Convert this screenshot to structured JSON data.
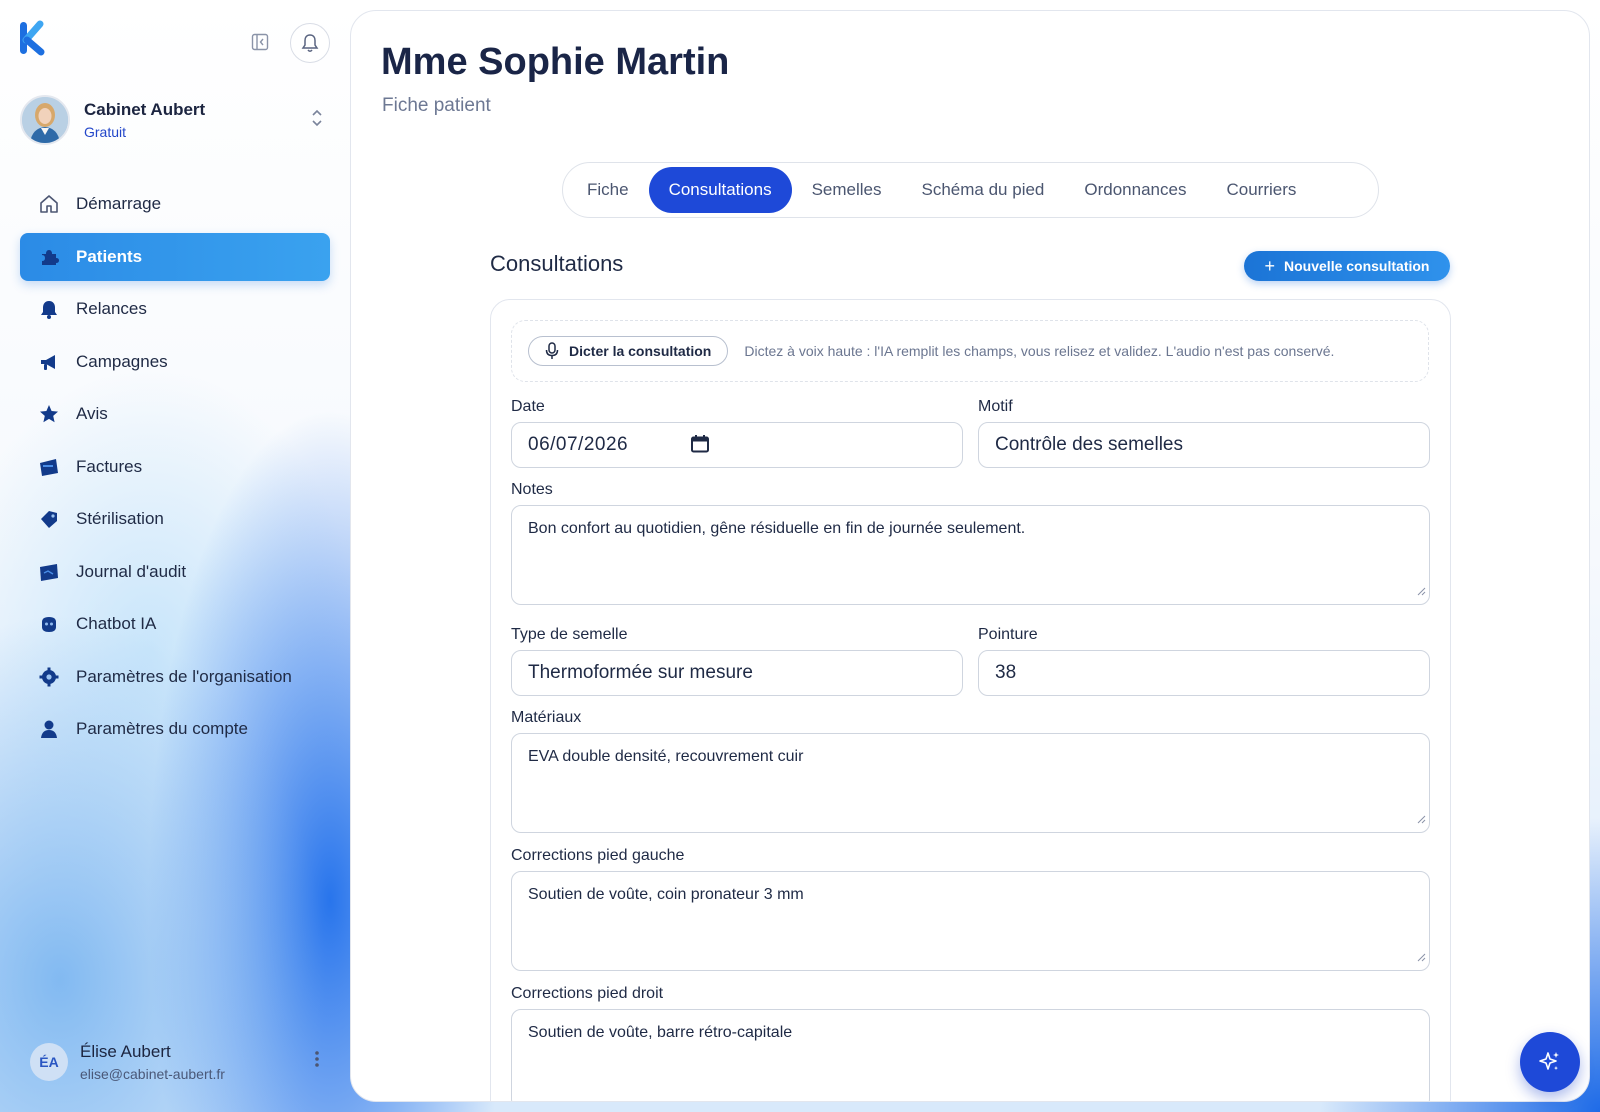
{
  "sidebar": {
    "org": {
      "name": "Cabinet Aubert",
      "plan": "Gratuit"
    },
    "items": [
      {
        "label": "Démarrage",
        "icon": "home-icon",
        "active": false
      },
      {
        "label": "Patients",
        "icon": "puzzle-icon",
        "active": true
      },
      {
        "label": "Relances",
        "icon": "bell-icon",
        "active": false
      },
      {
        "label": "Campagnes",
        "icon": "megaphone-icon",
        "active": false
      },
      {
        "label": "Avis",
        "icon": "star-icon",
        "active": false
      },
      {
        "label": "Factures",
        "icon": "wallet-icon",
        "active": false
      },
      {
        "label": "Stérilisation",
        "icon": "tag-icon",
        "active": false
      },
      {
        "label": "Journal d'audit",
        "icon": "journal-icon",
        "active": false
      },
      {
        "label": "Chatbot IA",
        "icon": "bot-icon",
        "active": false
      },
      {
        "label": "Paramètres de l'organisation",
        "icon": "gear-icon",
        "active": false
      },
      {
        "label": "Paramètres du compte",
        "icon": "user-icon",
        "active": false
      }
    ],
    "user": {
      "initials": "ÉA",
      "name": "Élise Aubert",
      "email": "elise@cabinet-aubert.fr"
    }
  },
  "header": {
    "title": "Mme Sophie Martin",
    "subtitle": "Fiche patient"
  },
  "tabs": [
    {
      "label": "Fiche",
      "active": false
    },
    {
      "label": "Consultations",
      "active": true
    },
    {
      "label": "Semelles",
      "active": false
    },
    {
      "label": "Schéma du pied",
      "active": false
    },
    {
      "label": "Ordonnances",
      "active": false
    },
    {
      "label": "Courriers",
      "active": false
    }
  ],
  "consultations": {
    "title": "Consultations",
    "new_button": "Nouvelle consultation",
    "dictate_button": "Dicter la consultation",
    "dictate_hint": "Dictez à voix haute : l'IA remplit les champs, vous relisez et validez. L'audio n'est pas conservé.",
    "form": {
      "date_label": "Date",
      "date_value": "06/07/2026",
      "motif_label": "Motif",
      "motif_value": "Contrôle des semelles",
      "notes_label": "Notes",
      "notes_value": "Bon confort au quotidien, gêne résiduelle en fin de journée seulement.",
      "type_label": "Type de semelle",
      "type_value": "Thermoformée sur mesure",
      "pointure_label": "Pointure",
      "pointure_value": "38",
      "materiaux_label": "Matériaux",
      "materiaux_value": "EVA double densité, recouvrement cuir",
      "corr_gauche_label": "Corrections pied gauche",
      "corr_gauche_value": "Soutien de voûte, coin pronateur 3 mm",
      "corr_droit_label": "Corrections pied droit",
      "corr_droit_value": "Soutien de voûte, barre rétro-capitale"
    }
  },
  "colors": {
    "primary": "#1e49d8",
    "sidebar_active": "#2b8be6",
    "text": "#1f2a45"
  }
}
